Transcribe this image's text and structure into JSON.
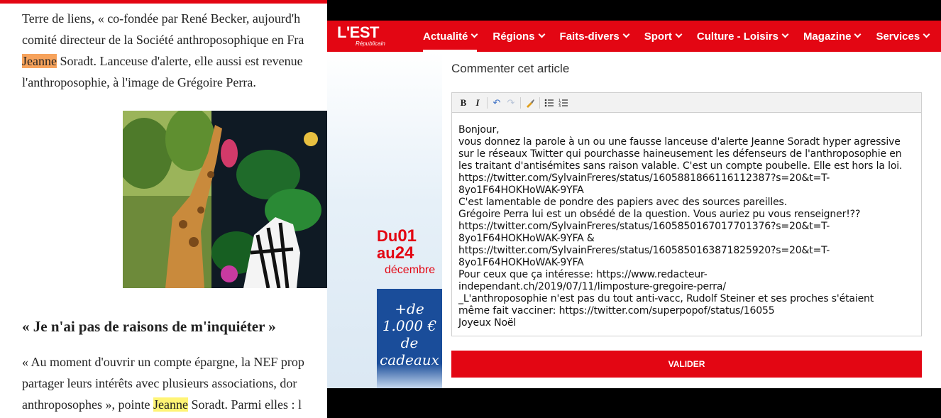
{
  "article": {
    "paragraph1": [
      "Terre de liens, « co-fondée par René Becker, aujourd'h",
      "comité directeur de la Société anthroposophique en Fra",
      [
        "Jeanne",
        " Soradt. Lanceuse d'alerte, elle aussi est revenue"
      ],
      "l'anthroposophie, à l'image de Grégoire Perra."
    ],
    "heading": "« Je n'ai pas de raisons de m'inquiéter »",
    "paragraph2": [
      "« Au moment d'ouvrir un compte épargne, la NEF prop",
      "partager leurs intérêts avec plusieurs associations, dor",
      [
        "anthroposophes », pointe ",
        "Jeanne",
        " Soradt. Parmi elles : l"
      ]
    ]
  },
  "site": {
    "logo": "L'EST",
    "logo_sub": "Républicain",
    "brand_color": "#e30613",
    "nav": [
      "Actualité",
      "Régions",
      "Faits-divers",
      "Sport",
      "Culture - Loisirs",
      "Magazine",
      "Services"
    ]
  },
  "ad": {
    "du": "Du",
    "d1": "01",
    "au": "au",
    "d2": "24",
    "month": "décembre",
    "promo_line1": "+de",
    "promo_line2": "1.000 €",
    "promo_line3": "de",
    "promo_line4": "cadeaux"
  },
  "comment": {
    "title": "Commenter cet article",
    "toolbar": [
      "bold-icon",
      "italic-icon",
      "undo-icon",
      "redo-icon",
      "clear-format-icon",
      "bullet-list-icon",
      "numbered-list-icon"
    ],
    "text": "Bonjour,\nvous donnez la parole à un ou une fausse lanceuse d'alerte Jeanne Soradt hyper agressive\nsur le réseaux Twitter qui pourchasse haineusement les défenseurs de l'anthroposophie en\nles traitant d'antisémites sans raison valable. C'est un compte poubelle. Elle est hors la loi.\nhttps://twitter.com/SylvainFreres/status/1605881866116112387?s=20&t=T-\n8yo1F64HOKHoWAK-9YFA\nC'est lamentable de pondre des papiers avec des sources pareilles.\nGrégoire Perra lui est un obsédé de la question. Vous auriez pu vous renseigner!??\nhttps://twitter.com/SylvainFreres/status/1605850167017701376?s=20&t=T-\n8yo1F64HOKHoWAK-9YFA &\nhttps://twitter.com/SylvainFreres/status/1605850163871825920?s=20&t=T-\n8yo1F64HOKHoWAK-9YFA\nPour ceux que ça intéresse: https://www.redacteur-\nindependant.ch/2019/07/11/limposture-gregoire-perra/\n_L'anthroposophie n'est pas du tout anti-vacc, Rudolf Steiner et ses proches s'étaient\nmême fait vacciner: https://twitter.com/superpopof/status/16055\nJoyeux Noël",
    "submit": "VALIDER"
  }
}
